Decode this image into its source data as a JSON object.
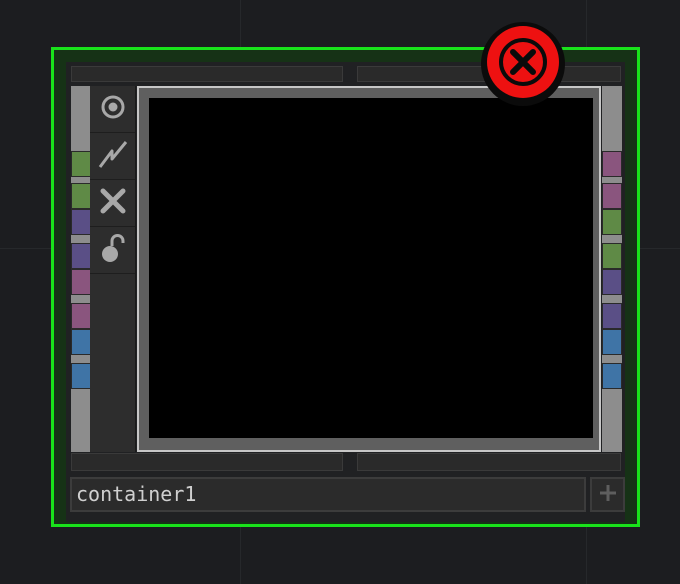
{
  "node": {
    "name": "container1",
    "accent_color": "#19e21b",
    "state": "error"
  },
  "toolbar": {
    "items": [
      {
        "icon": "viewer-toggle-icon"
      },
      {
        "icon": "bypass-icon"
      },
      {
        "icon": "close-icon"
      },
      {
        "icon": "lock-icon"
      }
    ]
  },
  "connectors": {
    "left": [
      "#5f8a46",
      "#5f8a46",
      "#5a4f86",
      "#5a4f86",
      "#8a557e",
      "#8a557e",
      "#3f74a6",
      "#3f74a6"
    ],
    "right": [
      "#8a557e",
      "#8a557e",
      "#5f8a46",
      "#5f8a46",
      "#5a4f86",
      "#5a4f86",
      "#3f74a6",
      "#3f74a6"
    ]
  },
  "badge": {
    "icon": "error-x-icon",
    "color": "#ee1111"
  },
  "add_button": {
    "icon": "plus-icon"
  }
}
